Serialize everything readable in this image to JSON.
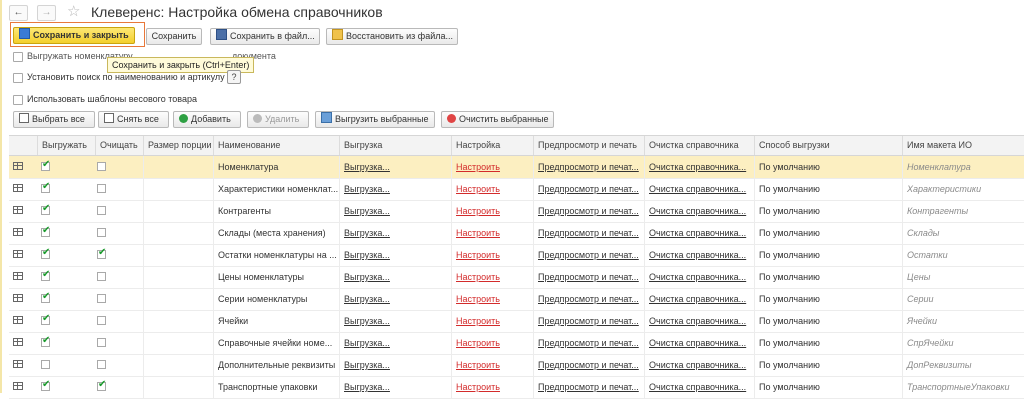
{
  "window": {
    "title": "Клеверенс: Настройка обмена справочников",
    "back_icon": "arrow-left",
    "forward_icon": "arrow-right"
  },
  "toolbar": {
    "save_close": "Сохранить и закрыть",
    "save": "Сохранить",
    "save_file": "Сохранить в файл...",
    "restore_file": "Восстановить из файла..."
  },
  "tooltip": "Сохранить и закрыть (Ctrl+Enter)",
  "options": {
    "export_nomenclature_partial": "Выгружать номенклатуру",
    "export_doc_partial": "документа",
    "search_by_name": "Установить поиск по наименованию и артикулу",
    "help": "?",
    "weight_templates": "Использовать шаблоны весового товара"
  },
  "actions": {
    "select_all": "Выбрать все",
    "deselect_all": "Снять все",
    "add": "Добавить",
    "delete": "Удалить",
    "export_selected": "Выгрузить выбранные",
    "clear_selected": "Очистить выбранные"
  },
  "columns": [
    "Выгружать",
    "Очищать",
    "Размер порции",
    "Наименование",
    "Выгрузка",
    "Настройка",
    "Предпросмотр и печать",
    "Очистка справочника",
    "Способ выгрузки",
    "Имя макета ИО"
  ],
  "rows": [
    {
      "export": true,
      "clear": false,
      "name": "Номенклатура",
      "unload": "Выгрузка...",
      "setup": "Настроить",
      "preview": "Предпросмотр и печат...",
      "cleanup": "Очистка справочника...",
      "method": "По умолчанию",
      "layout": "Номенклатура",
      "selected": true
    },
    {
      "export": true,
      "clear": false,
      "name": "Характеристики номенклат...",
      "unload": "Выгрузка...",
      "setup": "Настроить",
      "preview": "Предпросмотр и печат...",
      "cleanup": "Очистка справочника...",
      "method": "По умолчанию",
      "layout": "Характеристики"
    },
    {
      "export": true,
      "clear": false,
      "name": "Контрагенты",
      "unload": "Выгрузка...",
      "setup": "Настроить",
      "preview": "Предпросмотр и печат...",
      "cleanup": "Очистка справочника...",
      "method": "По умолчанию",
      "layout": "Контрагенты"
    },
    {
      "export": true,
      "clear": false,
      "name": "Склады (места хранения)",
      "unload": "Выгрузка...",
      "setup": "Настроить",
      "preview": "Предпросмотр и печат...",
      "cleanup": "Очистка справочника...",
      "method": "По умолчанию",
      "layout": "Склады"
    },
    {
      "export": true,
      "clear": true,
      "name": "Остатки номенклатуры на ...",
      "unload": "Выгрузка...",
      "setup": "Настроить",
      "preview": "Предпросмотр и печат...",
      "cleanup": "Очистка справочника...",
      "method": "По умолчанию",
      "layout": "Остатки"
    },
    {
      "export": true,
      "clear": false,
      "name": "Цены номенклатуры",
      "unload": "Выгрузка...",
      "setup": "Настроить",
      "preview": "Предпросмотр и печат...",
      "cleanup": "Очистка справочника...",
      "method": "По умолчанию",
      "layout": "Цены"
    },
    {
      "export": true,
      "clear": false,
      "name": "Серии номенклатуры",
      "unload": "Выгрузка...",
      "setup": "Настроить",
      "preview": "Предпросмотр и печат...",
      "cleanup": "Очистка справочника...",
      "method": "По умолчанию",
      "layout": "Серии"
    },
    {
      "export": true,
      "clear": false,
      "name": "Ячейки",
      "unload": "Выгрузка...",
      "setup": "Настроить",
      "preview": "Предпросмотр и печат...",
      "cleanup": "Очистка справочника...",
      "method": "По умолчанию",
      "layout": "Ячейки"
    },
    {
      "export": true,
      "clear": false,
      "name": "Справочные ячейки номе...",
      "unload": "Выгрузка...",
      "setup": "Настроить",
      "preview": "Предпросмотр и печат...",
      "cleanup": "Очистка справочника...",
      "method": "По умолчанию",
      "layout": "СпрЯчейки"
    },
    {
      "export": false,
      "clear": false,
      "name": "Дополнительные реквизиты",
      "unload": "Выгрузка...",
      "setup": "Настроить",
      "preview": "Предпросмотр и печат...",
      "cleanup": "Очистка справочника...",
      "method": "По умолчанию",
      "layout": "ДопРеквизиты"
    },
    {
      "export": true,
      "clear": true,
      "name": "Транспортные упаковки",
      "unload": "Выгрузка...",
      "setup": "Настроить",
      "preview": "Предпросмотр и печат...",
      "cleanup": "Очистка справочника...",
      "method": "По умолчанию",
      "layout": "ТранспортныеУпаковки"
    }
  ]
}
